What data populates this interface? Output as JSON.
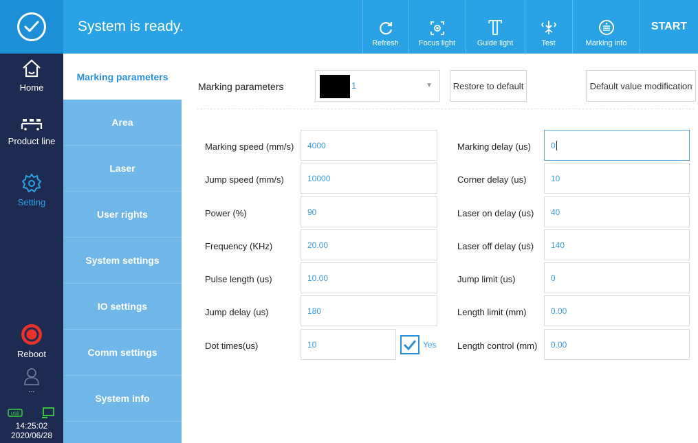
{
  "header": {
    "status": "System is ready.",
    "tools": [
      {
        "label": "Refresh",
        "icon": "refresh-icon"
      },
      {
        "label": "Focus light",
        "icon": "focus-light-icon"
      },
      {
        "label": "Guide light",
        "icon": "guide-light-icon"
      },
      {
        "label": "Test",
        "icon": "test-icon"
      },
      {
        "label": "Marking info",
        "icon": "marking-info-icon"
      }
    ],
    "start_label": "START"
  },
  "leftnav": {
    "items": [
      {
        "label": "Home",
        "icon": "home-icon"
      },
      {
        "label": "Product line",
        "icon": "product-line-icon"
      },
      {
        "label": "Setting",
        "icon": "gear-icon"
      },
      {
        "label": "Reboot",
        "icon": "reboot-icon"
      },
      {
        "label": "...",
        "icon": "user-icon"
      }
    ],
    "time": "14:25:02",
    "date": "2020/06/28"
  },
  "sidebar": {
    "items": [
      {
        "label": "Marking parameters",
        "active": true
      },
      {
        "label": "Area"
      },
      {
        "label": "Laser"
      },
      {
        "label": "User rights"
      },
      {
        "label": "System settings"
      },
      {
        "label": "IO settings"
      },
      {
        "label": "Comm settings"
      },
      {
        "label": "System info"
      }
    ]
  },
  "main": {
    "param_label": "Marking parameters",
    "param_select_value": "1",
    "restore_label": "Restore to default",
    "default_mod_label": "Default value modification",
    "left_fields": [
      {
        "label": "Marking speed (mm/s)",
        "value": "4000"
      },
      {
        "label": "Jump speed (mm/s)",
        "value": "10000"
      },
      {
        "label": "Power (%)",
        "value": "90"
      },
      {
        "label": "Frequency (KHz)",
        "value": "20.00"
      },
      {
        "label": "Pulse length (us)",
        "value": "10.00"
      },
      {
        "label": "Jump delay (us)",
        "value": "180"
      },
      {
        "label": "Dot times(us)",
        "value": "10"
      }
    ],
    "right_fields": [
      {
        "label": "Marking delay (us)",
        "value": "0"
      },
      {
        "label": "Corner delay (us)",
        "value": "10"
      },
      {
        "label": "Laser on delay (us)",
        "value": "40"
      },
      {
        "label": "Laser off delay (us)",
        "value": "140"
      },
      {
        "label": "Jump limit (us)",
        "value": "0"
      },
      {
        "label": "Length limit (mm)",
        "value": "0.00"
      },
      {
        "label": "Length control (mm)",
        "value": "0.00"
      }
    ],
    "dot_checkbox_label": "Yes",
    "dot_checkbox_checked": true
  },
  "colors": {
    "topbar": "#2aa3e6",
    "nav_dark": "#1e2b50",
    "sidebar": "#6fb7e9",
    "accent": "#2a8fd9",
    "value_text": "#3a9ae0",
    "reboot_red": "#e8332a"
  }
}
